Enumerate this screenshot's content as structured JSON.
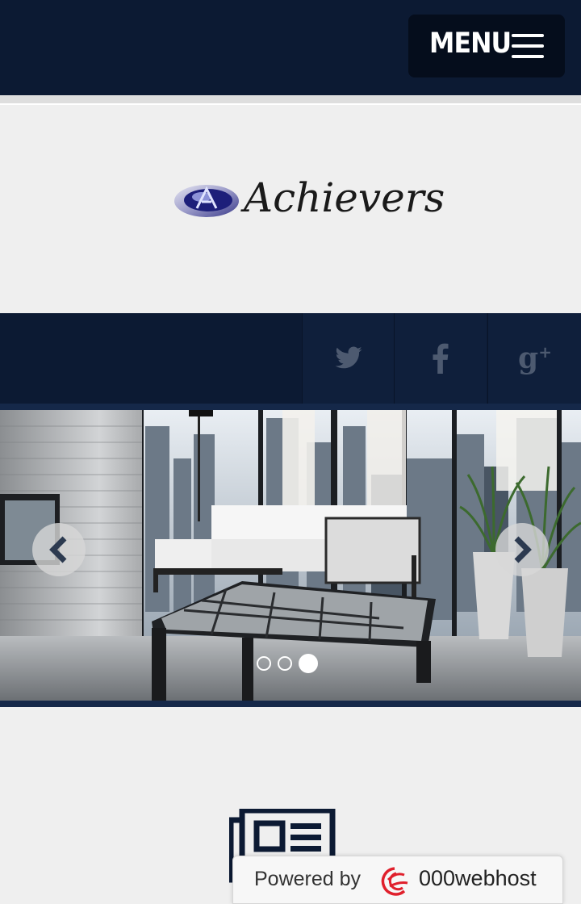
{
  "header": {
    "menu_label": "MENU",
    "menu_icon": "hamburger-icon"
  },
  "logo": {
    "text": "Achievers",
    "icon": "achievers-logo-emblem"
  },
  "social": [
    {
      "name": "twitter",
      "icon": "twitter-icon"
    },
    {
      "name": "facebook",
      "icon": "facebook-icon"
    },
    {
      "name": "google-plus",
      "icon": "google-plus-icon"
    }
  ],
  "slider": {
    "prev_icon": "chevron-left-icon",
    "next_icon": "chevron-right-icon",
    "slide_count": 3,
    "active_slide": 3
  },
  "content": {
    "section_icon": "newspaper-icon"
  },
  "footer_badge": {
    "prefix": "Powered by",
    "brand": "000webhost",
    "brand_icon": "000webhost-logo-icon"
  },
  "colors": {
    "navy": "#0c1a33",
    "navy_dark": "#050d1c",
    "background": "#efefef"
  }
}
